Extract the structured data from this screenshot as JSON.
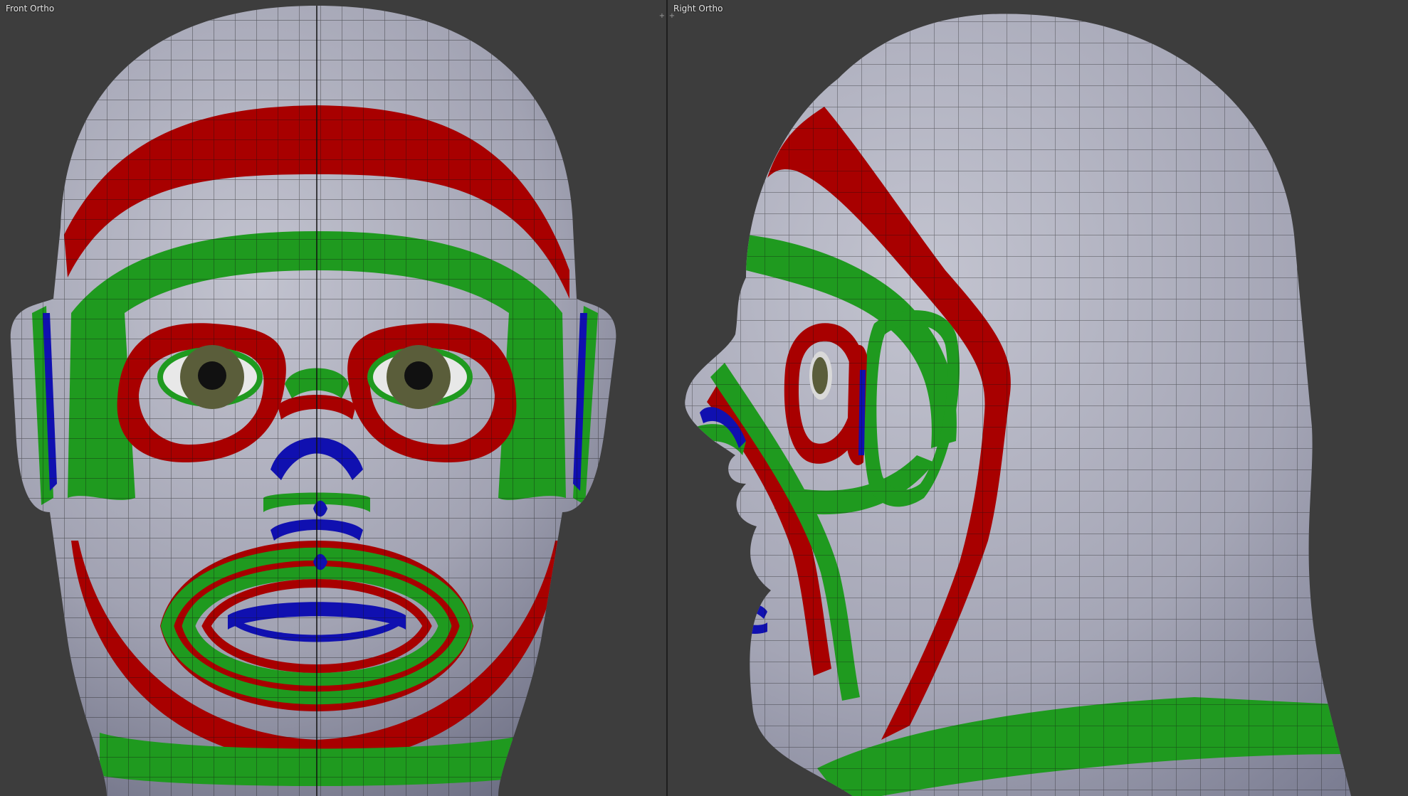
{
  "viewports": {
    "left": {
      "label": "Front Ortho"
    },
    "right": {
      "label": "Right Ortho"
    }
  },
  "colors": {
    "background": "#3d3d3d",
    "skin": "#a9aab8",
    "skin_shadow": "#6f7184",
    "wire": "#111111",
    "red_loop": "#a80000",
    "green_loop": "#1f9a1f",
    "blue_loop": "#1010b0",
    "iris": "#5a5d3a",
    "pupil": "#111111"
  },
  "split_widget": {
    "icon_left": "plus-icon",
    "icon_right": "plus-icon"
  }
}
